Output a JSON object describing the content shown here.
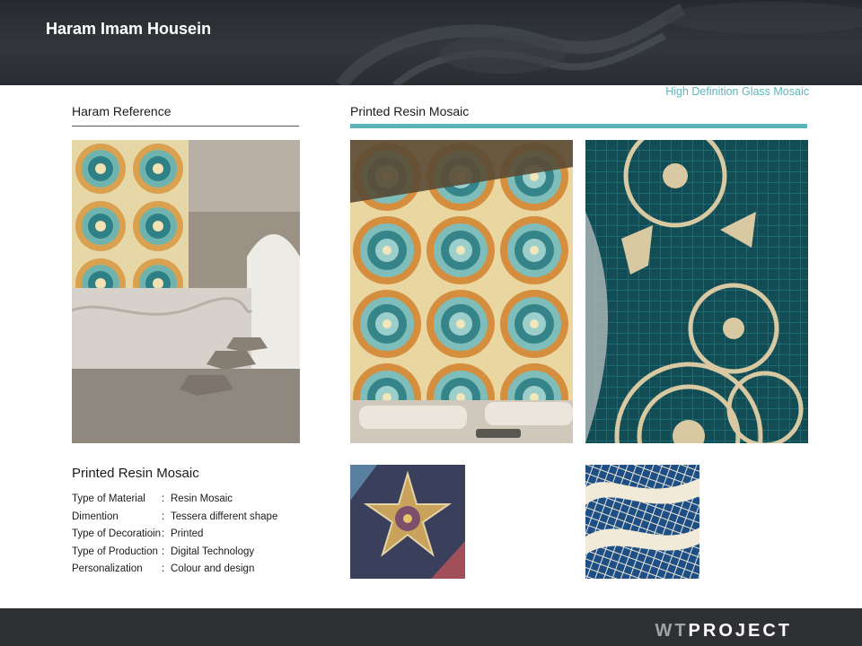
{
  "header": {
    "title": "Haram Imam Housein"
  },
  "subtitle": "High Definition Glass Mosaic",
  "sections": {
    "reference": "Haram Reference",
    "product": "Printed Resin Mosaic"
  },
  "specs": {
    "title": "Printed Resin Mosaic",
    "rows": [
      {
        "label": "Type of Material",
        "value": "Resin Mosaic"
      },
      {
        "label": "Dimention",
        "value": "Tessera different shape"
      },
      {
        "label": "Type of Decoratioin",
        "value": "Printed"
      },
      {
        "label": "Type of Production",
        "value": "Digital Technology"
      },
      {
        "label": "Personalization",
        "value": "Colour and design"
      }
    ],
    "separator": ":"
  },
  "footer": {
    "logo_prefix": "WT",
    "logo_suffix": "PROJECT"
  },
  "colors": {
    "accent": "#5db4b8",
    "header_bg": "#2e3236",
    "footer_bg": "#2e3033"
  }
}
